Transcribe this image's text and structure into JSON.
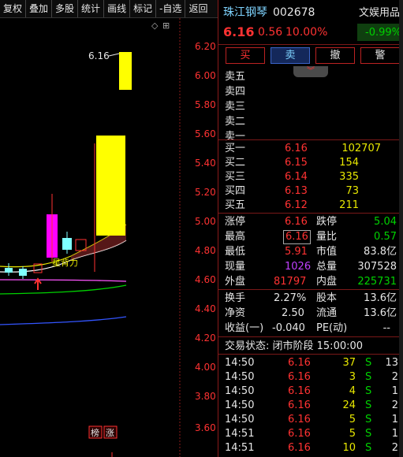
{
  "toolbar": {
    "items": [
      "复权",
      "叠加",
      "多股",
      "统计",
      "画线",
      "标记",
      "-自选",
      "返回"
    ]
  },
  "chart": {
    "price_axis": [
      "6.20",
      "6.00",
      "5.80",
      "5.60",
      "5.40",
      "5.20",
      "5.00",
      "4.80",
      "4.60",
      "4.40",
      "4.20",
      "4.00",
      "3.80",
      "3.60"
    ],
    "high_label": "6.16",
    "annotation": "星背力",
    "badges": [
      "榜",
      "涨"
    ],
    "colors": {
      "up": "#ff3232",
      "limit_up": "#ffff00",
      "strong": "#ff00ff",
      "down": "#7fffff"
    }
  },
  "stock": {
    "name": "珠江钢琴",
    "code": "002678",
    "sector": "文娱用品",
    "sector_change": "-0.99%",
    "price": "6.16",
    "change": "0.56",
    "change_pct": "10.00%"
  },
  "trade_buttons": {
    "buy": "买",
    "sell": "卖",
    "cancel": "撤",
    "alert": "警"
  },
  "sell_orders": [
    {
      "label": "卖五"
    },
    {
      "label": "卖四"
    },
    {
      "label": "卖三"
    },
    {
      "label": "卖二"
    },
    {
      "label": "卖一"
    }
  ],
  "buy_orders": [
    {
      "label": "买一",
      "price": "6.16",
      "volume": "102707"
    },
    {
      "label": "买二",
      "price": "6.15",
      "volume": "154"
    },
    {
      "label": "买三",
      "price": "6.14",
      "volume": "335"
    },
    {
      "label": "买四",
      "price": "6.13",
      "volume": "73"
    },
    {
      "label": "买五",
      "price": "6.12",
      "volume": "211"
    }
  ],
  "stats": [
    {
      "l1": "涨停",
      "v1": "6.16",
      "l2": "跌停",
      "v2": "5.04"
    },
    {
      "l1": "最高",
      "v1": "6.16",
      "l2": "量比",
      "v2": "0.57"
    },
    {
      "l1": "最低",
      "v1": "5.91",
      "l2": "市值",
      "v2": "83.8亿"
    },
    {
      "l1": "现量",
      "v1": "1026",
      "l2": "总量",
      "v2": "307528"
    },
    {
      "l1": "外盘",
      "v1": "81797",
      "l2": "内盘",
      "v2": "225731"
    }
  ],
  "fundamentals": [
    {
      "l1": "换手",
      "v1": "2.27%",
      "l2": "股本",
      "v2": "13.6亿"
    },
    {
      "l1": "净资",
      "v1": "2.50",
      "l2": "流通",
      "v2": "13.6亿"
    },
    {
      "l1": "收益(一)",
      "v1": "-0.040",
      "l2": "PE(动)",
      "v2": "--"
    }
  ],
  "trade_status": "交易状态: 闭市阶段 15:00:00",
  "ticks": [
    {
      "time": "14:50",
      "price": "6.16",
      "vol": "37",
      "side": "S",
      "num": "13"
    },
    {
      "time": "14:50",
      "price": "6.16",
      "vol": "3",
      "side": "S",
      "num": "2"
    },
    {
      "time": "14:50",
      "price": "6.16",
      "vol": "4",
      "side": "S",
      "num": "1"
    },
    {
      "time": "14:50",
      "price": "6.16",
      "vol": "24",
      "side": "S",
      "num": "2"
    },
    {
      "time": "14:50",
      "price": "6.16",
      "vol": "5",
      "side": "S",
      "num": "1"
    },
    {
      "time": "14:51",
      "price": "6.16",
      "vol": "5",
      "side": "S",
      "num": "1"
    },
    {
      "time": "14:51",
      "price": "6.16",
      "vol": "10",
      "side": "S",
      "num": "2"
    }
  ]
}
